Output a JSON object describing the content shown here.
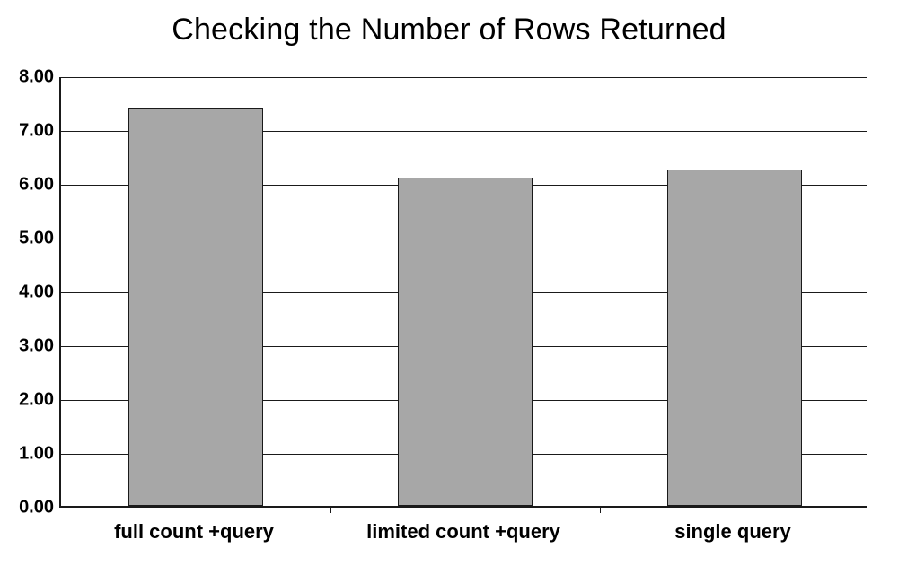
{
  "chart_data": {
    "type": "bar",
    "title": "Checking the Number of Rows Returned",
    "categories": [
      "full count +query",
      "limited count +query",
      "single query"
    ],
    "values": [
      7.4,
      6.1,
      6.25
    ],
    "xlabel": "",
    "ylabel": "",
    "ylim": [
      0,
      8
    ],
    "yticks": [
      0.0,
      1.0,
      2.0,
      3.0,
      4.0,
      5.0,
      6.0,
      7.0,
      8.0
    ],
    "ytick_labels": [
      "0.00",
      "1.00",
      "2.00",
      "3.00",
      "4.00",
      "5.00",
      "6.00",
      "7.00",
      "8.00"
    ],
    "colors": {
      "bar_fill": "#a7a7a7",
      "axis": "#1a1a1a"
    }
  }
}
